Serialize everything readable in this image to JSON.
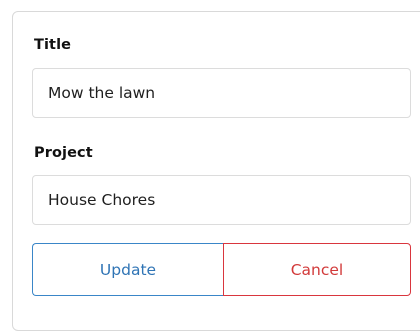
{
  "form": {
    "title": {
      "label": "Title",
      "value": "Mow the lawn"
    },
    "project": {
      "label": "Project",
      "value": "House Chores"
    },
    "actions": {
      "update_label": "Update",
      "cancel_label": "Cancel"
    }
  },
  "colors": {
    "update": "#2f74b5",
    "cancel": "#d23a3a",
    "border": "#dcdcdc"
  }
}
